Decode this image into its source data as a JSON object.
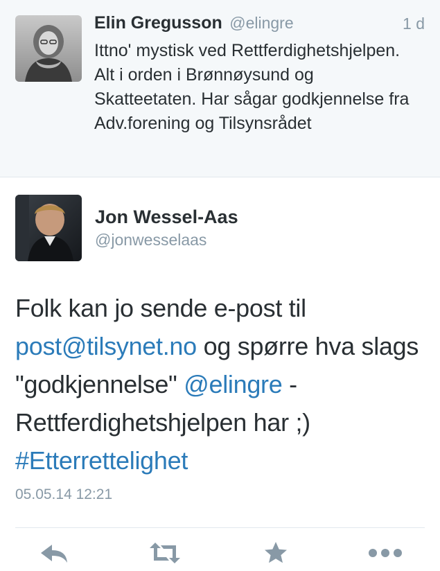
{
  "parent_tweet": {
    "author_name": "Elin Gregusson",
    "author_handle": "@elingre",
    "time_ago": "1 d",
    "text": "Ittno' mystisk ved Rettferdighetshjelpen. Alt i orden i Brønnøysund og Skatteetaten. Har sågar godkjennelse fra Adv.forening og Tilsynsrådet"
  },
  "main_tweet": {
    "author_name": "Jon Wessel-Aas",
    "author_handle": "@jonwesselaas",
    "text_parts": {
      "p1": "Folk kan jo sende e-post til ",
      "email": "post@tilsynet.no",
      "p2": " og spørre hva slags \"godkjennelse\" ",
      "mention": "@elingre",
      "p3": " - Rettferdighetshjelpen har ;) ",
      "hashtag": "#Etterrettelighet"
    },
    "timestamp": "05.05.14 12:21"
  },
  "actions": [
    {
      "name": "reply",
      "icon": "reply-icon"
    },
    {
      "name": "retweet",
      "icon": "retweet-icon"
    },
    {
      "name": "favorite",
      "icon": "star-icon"
    },
    {
      "name": "more",
      "icon": "more-icon"
    }
  ],
  "colors": {
    "link": "#2b7bb9",
    "secondary_text": "#8899a6",
    "primary_text": "#292f33",
    "parent_background": "#f5f8fa",
    "icon": "#8899a6"
  }
}
